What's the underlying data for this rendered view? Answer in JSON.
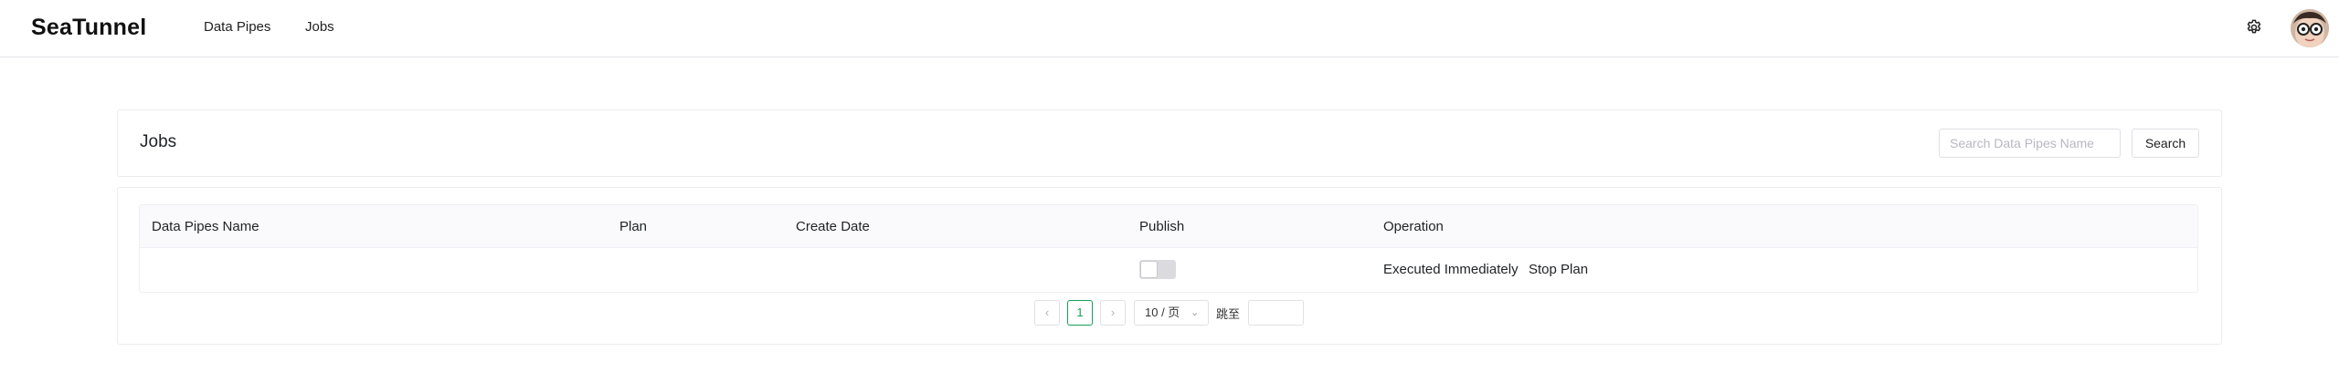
{
  "header": {
    "logo": "SeaTunnel",
    "nav": [
      "Data Pipes",
      "Jobs"
    ],
    "settings_icon": "gear-icon",
    "avatar_icon": "avatar"
  },
  "jobs_panel": {
    "title": "Jobs",
    "search": {
      "placeholder": "Search Data Pipes Name",
      "value": ""
    },
    "search_button": "Search"
  },
  "table": {
    "columns": [
      "Data Pipes Name",
      "Plan",
      "Create Date",
      "Publish",
      "Operation"
    ],
    "rows": [
      {
        "name": "",
        "plan": "",
        "create_date": "",
        "publish": false,
        "operations": [
          "Executed Immediately",
          "Stop Plan"
        ]
      }
    ]
  },
  "pagination": {
    "prev": "‹",
    "next": "›",
    "current_page": "1",
    "page_size": "10 / 页",
    "goto_label": "跳至",
    "goto_value": ""
  },
  "colors": {
    "accent": "#18a058",
    "border": "#e0e0e6",
    "header_bg": "#fafafc"
  }
}
